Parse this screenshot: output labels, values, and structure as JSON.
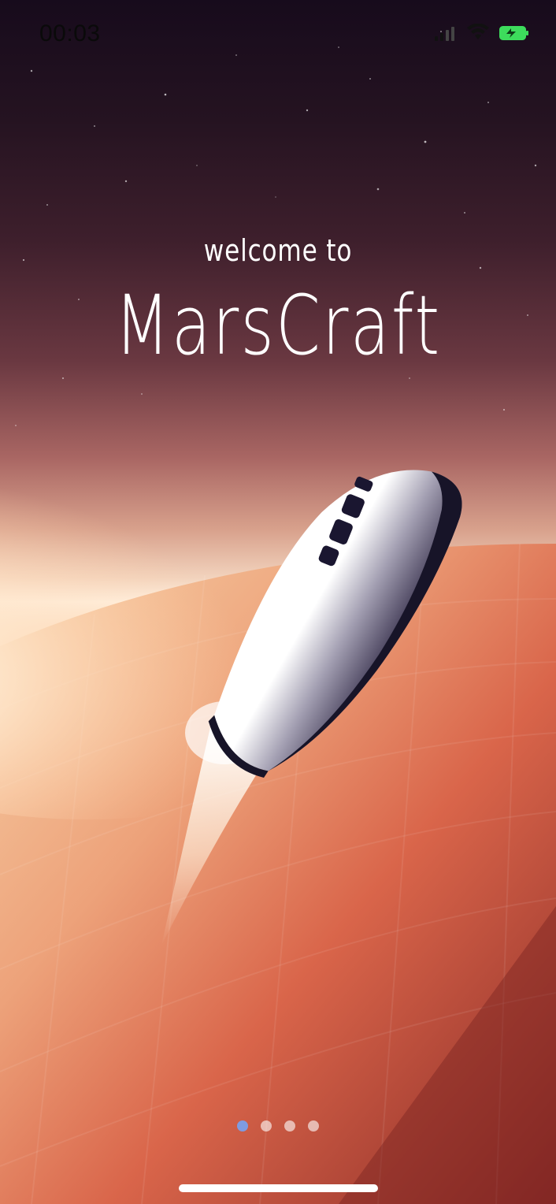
{
  "status_bar": {
    "time": "00:03",
    "signal_icon": "cellular-signal-icon",
    "wifi_icon": "wifi-icon",
    "battery_icon": "battery-charging-icon",
    "battery_color": "#3ddc5c"
  },
  "onboarding": {
    "welcome": "welcome to",
    "title": "MarsCraft"
  },
  "page_indicator": {
    "total": 4,
    "active_index": 0,
    "active_color": "#7f9be0"
  },
  "illustration": {
    "subject": "spaceship-over-mars",
    "planet_color": "#d9654a",
    "ship_color": "#ffffff"
  }
}
